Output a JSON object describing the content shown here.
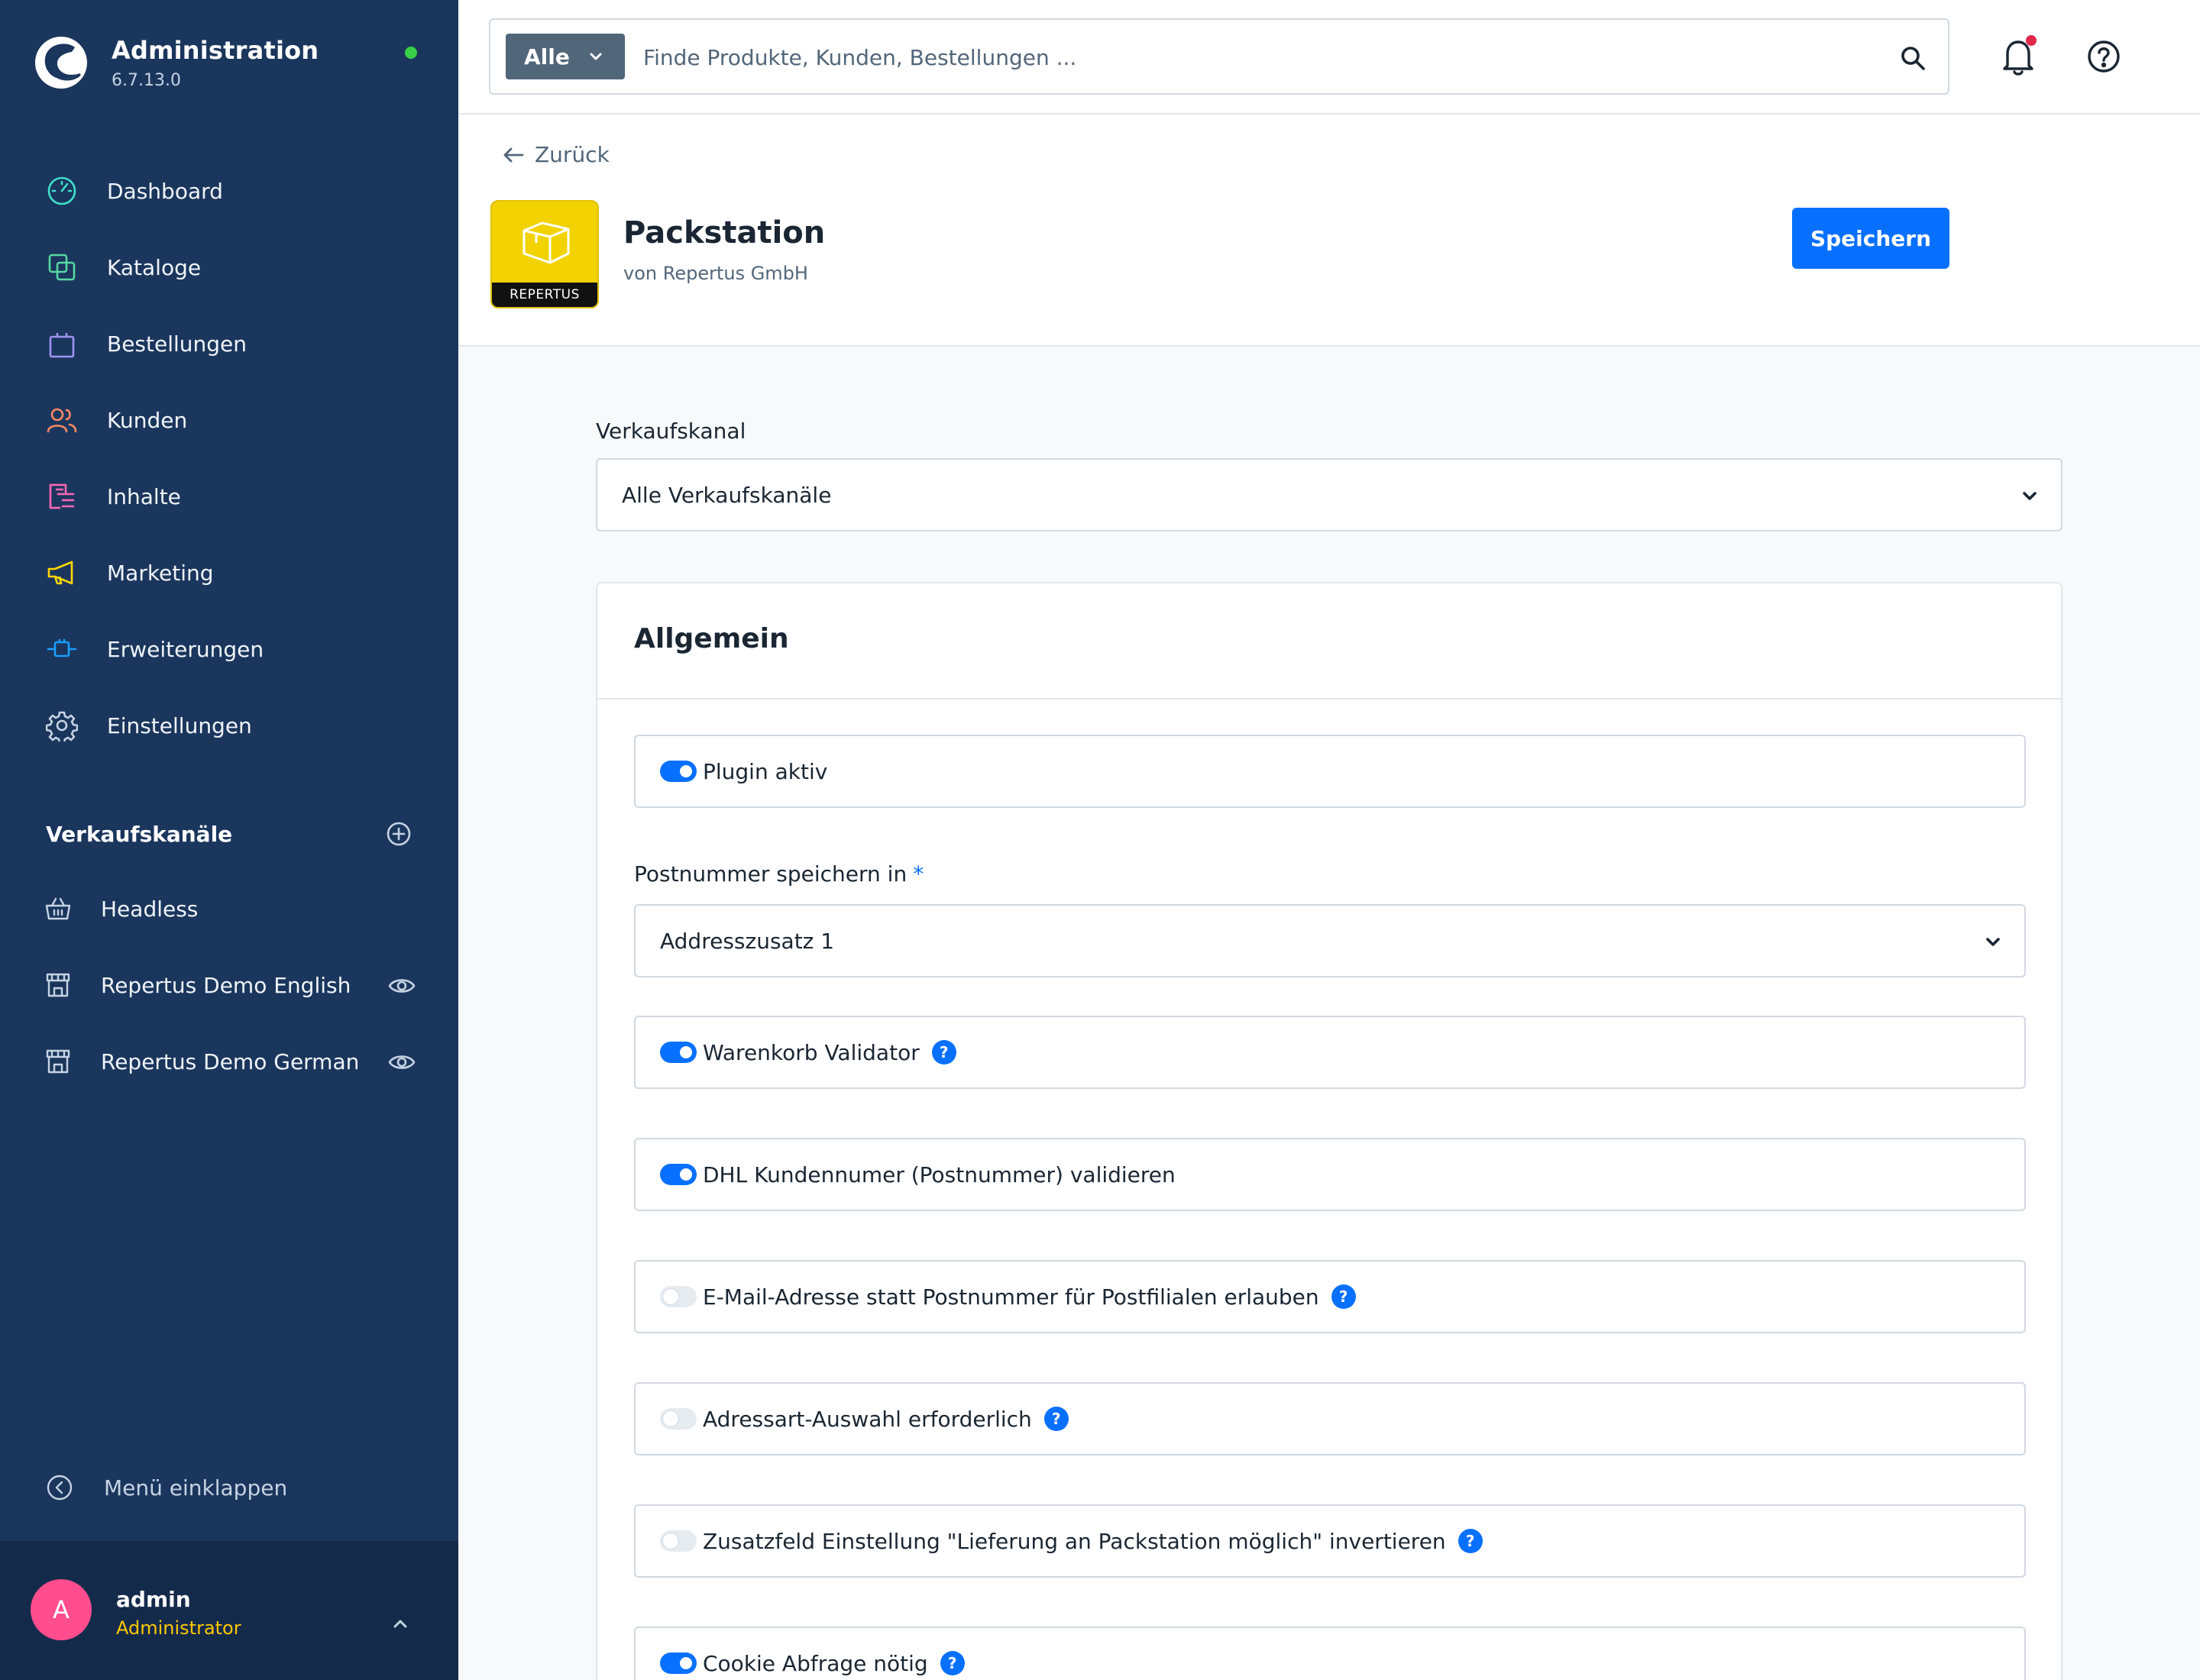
{
  "app": {
    "title": "Administration",
    "version": "6.7.13.0",
    "status_color": "#37d046"
  },
  "nav": {
    "items": [
      {
        "label": "Dashboard",
        "icon": "gauge-icon",
        "color": "#3de0c8"
      },
      {
        "label": "Kataloge",
        "icon": "catalog-icon",
        "color": "#57d9a3"
      },
      {
        "label": "Bestellungen",
        "icon": "shopping-bag-icon",
        "color": "#a092f0"
      },
      {
        "label": "Kunden",
        "icon": "users-icon",
        "color": "#f88962"
      },
      {
        "label": "Inhalte",
        "icon": "content-icon",
        "color": "#ff68b4"
      },
      {
        "label": "Marketing",
        "icon": "megaphone-icon",
        "color": "#ffd700"
      },
      {
        "label": "Erweiterungen",
        "icon": "plug-icon",
        "color": "#189eff"
      },
      {
        "label": "Einstellungen",
        "icon": "gear-icon",
        "color": "#c6d3e3"
      }
    ]
  },
  "sales_channels": {
    "title": "Verkaufskanäle",
    "items": [
      {
        "label": "Headless",
        "icon": "basket-icon"
      },
      {
        "label": "Repertus Demo English",
        "icon": "storefront-icon"
      },
      {
        "label": "Repertus Demo German",
        "icon": "storefront-icon"
      }
    ]
  },
  "collapse_label": "Menü einklappen",
  "user": {
    "initial": "A",
    "name": "admin",
    "role": "Administrator"
  },
  "search": {
    "type_label": "Alle",
    "placeholder": "Finde Produkte, Kunden, Bestellungen ..."
  },
  "header": {
    "back_label": "Zurück",
    "plugin_title": "Packstation",
    "plugin_vendor": "von Repertus GmbH",
    "logo_text": "REPERTUS",
    "save_label": "Speichern"
  },
  "form": {
    "sales_channel_label": "Verkaufskanal",
    "sales_channel_value": "Alle Verkaufskanäle",
    "card_title": "Allgemein",
    "plugin_active_label": "Plugin aktiv",
    "postnumber_label": "Postnummer speichern in",
    "required_mark": "*",
    "postnumber_value": "Addresszusatz 1",
    "switches": [
      {
        "label": "Warenkorb Validator",
        "on": true,
        "help": "?"
      },
      {
        "label": "DHL Kundennumer (Postnummer) validieren",
        "on": true
      },
      {
        "label": "E-Mail-Adresse statt Postnummer für Postfilialen erlauben",
        "on": false,
        "help": "?"
      },
      {
        "label": "Adressart-Auswahl erforderlich",
        "on": false,
        "help": "?"
      },
      {
        "label": "Zusatzfeld Einstellung \"Lieferung an Packstation möglich\" invertieren",
        "on": false,
        "help": "?"
      },
      {
        "label": "Cookie Abfrage nötig",
        "on": true,
        "help": "?"
      }
    ]
  }
}
